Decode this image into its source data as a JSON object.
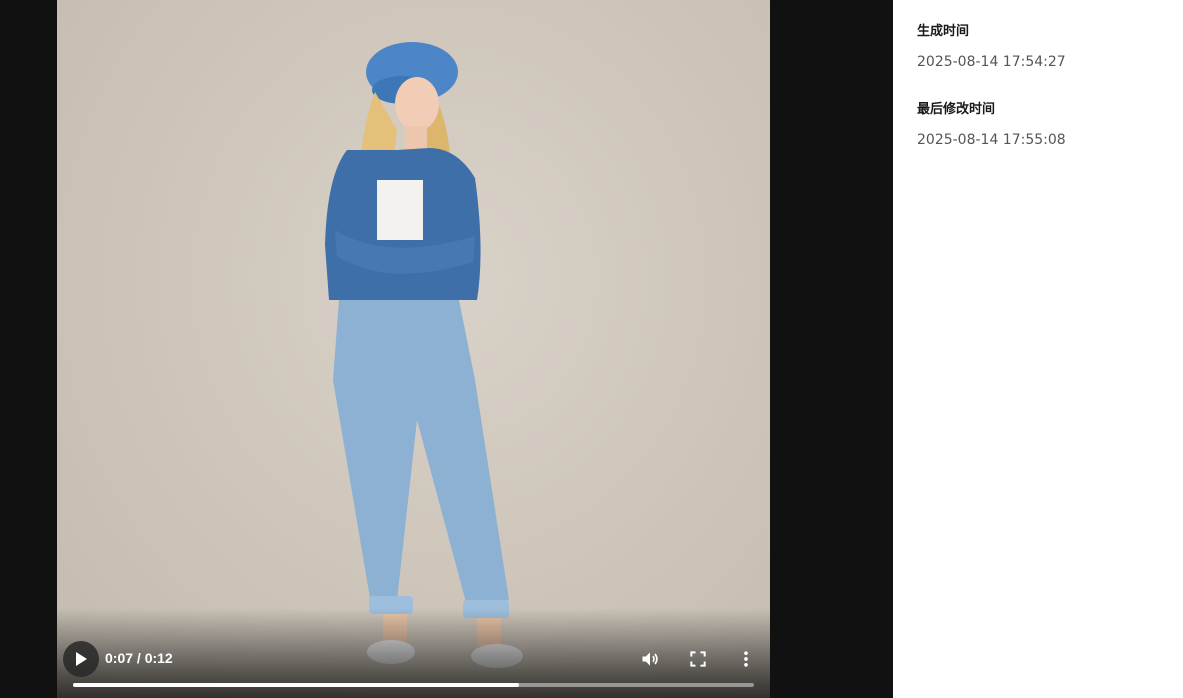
{
  "video": {
    "current_time": "0:07",
    "duration": "0:12",
    "time_display": "0:07 / 0:12",
    "progress": 0.655,
    "state": "paused",
    "icons": {
      "play": "play-icon",
      "volume": "volume-icon",
      "fullscreen": "fullscreen-icon",
      "more": "more-vertical-icon"
    }
  },
  "info": {
    "created_label": "生成时间",
    "created_value": "2025-08-14 17:54:27",
    "modified_label": "最后修改时间",
    "modified_value": "2025-08-14 17:55:08"
  },
  "colors": {
    "stage_background": "#111111",
    "panel_background": "#ffffff",
    "progress_fill": "#ffffff",
    "label_text": "#1a1a1a",
    "value_text": "#555555"
  }
}
